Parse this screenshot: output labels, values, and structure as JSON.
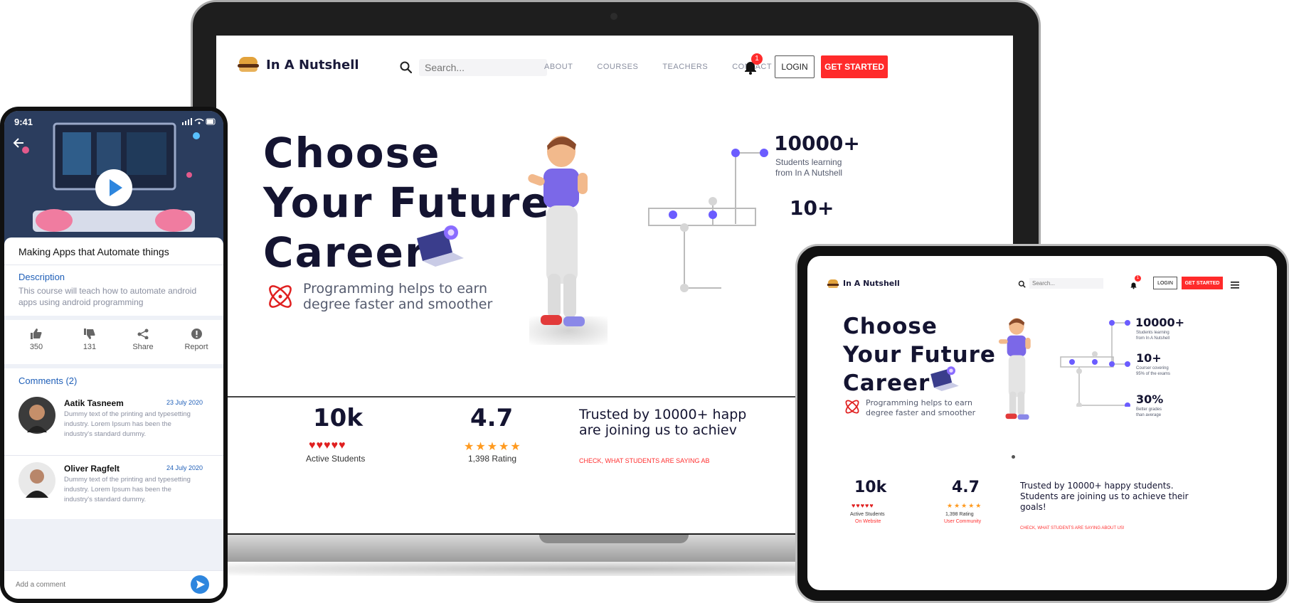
{
  "laptop": {
    "brand": "In A Nutshell",
    "search_placeholder": "Search...",
    "nav": [
      "ABOUT",
      "COURSES",
      "TEACHERS",
      "CONTACT"
    ],
    "notification_count": "1",
    "login": "LOGIN",
    "get_started": "GET STARTED",
    "hero": [
      "Choose",
      "Your Future",
      "Career"
    ],
    "tagline": [
      "Programming helps to earn",
      "degree faster and smoother"
    ],
    "stats": [
      {
        "value": "10000+",
        "lines": [
          "Students learning",
          "from In A Nutshell"
        ]
      },
      {
        "value": "10+",
        "lines": []
      }
    ],
    "metrics": {
      "students_value": "10k",
      "students_label": "Active Students",
      "rating_value": "4.7",
      "rating_label": "1,398 Rating",
      "hearts": "♥♥♥♥♥",
      "stars": "★★★★★"
    },
    "trusted": [
      "Trusted by 10000+ happ",
      "are joining us to achiev"
    ],
    "check": "CHECK, WHAT STUDENTS ARE SAYING AB"
  },
  "tablet": {
    "brand": "In A Nutshell",
    "search_placeholder": "Search...",
    "notification_count": "1",
    "login": "LOGIN",
    "get_started": "GET STARTED",
    "hero": [
      "Choose",
      "Your Future",
      "Career"
    ],
    "tagline": [
      "Programming helps to earn",
      "degree faster and smoother"
    ],
    "stats": [
      {
        "value": "10000+",
        "lines": [
          "Students learning",
          "from In A Nutshell"
        ]
      },
      {
        "value": "10+",
        "lines": [
          "Courser covering",
          "95% of the exams"
        ]
      },
      {
        "value": "30%",
        "lines": [
          "Better grades",
          "than average"
        ]
      }
    ],
    "metrics": {
      "students_value": "10k",
      "students_label": "Active Students",
      "students_sub": "On Website",
      "rating_value": "4.7",
      "rating_label": "1,398 Rating",
      "rating_sub": "User Community",
      "hearts": "♥♥♥♥♥",
      "stars": "★★★★★"
    },
    "trusted": [
      "Trusted by 10000+ happy students.",
      "Students are joining us to achieve their",
      "goals!"
    ],
    "check": "CHECK, WHAT STUDENTS ARE SAYING ABOUT US!"
  },
  "phone": {
    "time": "9:41",
    "course_title": "Making Apps  that Automate things",
    "description_heading": "Description",
    "description": [
      "This course will teach how to automate android",
      "apps  using android programming"
    ],
    "actions": [
      {
        "icon": "thumbs-up-icon",
        "label": "350"
      },
      {
        "icon": "thumbs-down-icon",
        "label": "131"
      },
      {
        "icon": "share-icon",
        "label": "Share"
      },
      {
        "icon": "report-icon",
        "label": "Report"
      }
    ],
    "comments_heading": "Comments (2)",
    "comments": [
      {
        "name": "Aatik Tasneem",
        "date": "23 July 2020",
        "text": [
          "Dummy text of the printing and typesetting",
          "industry. Lorem Ipsum has been the",
          "industry's standard dummy."
        ]
      },
      {
        "name": "Oliver Ragfelt",
        "date": "24 July 2020",
        "text": [
          "Dummy text of the printing and typesetting",
          "industry. Lorem Ipsum has been the",
          "industry's standard dummy."
        ]
      }
    ],
    "comment_placeholder": "Add a comment"
  },
  "colors": {
    "accent_red": "#ff2a2a",
    "navy": "#141431",
    "graph_blue": "#6b5cff",
    "link_blue": "#1f5fb8"
  }
}
